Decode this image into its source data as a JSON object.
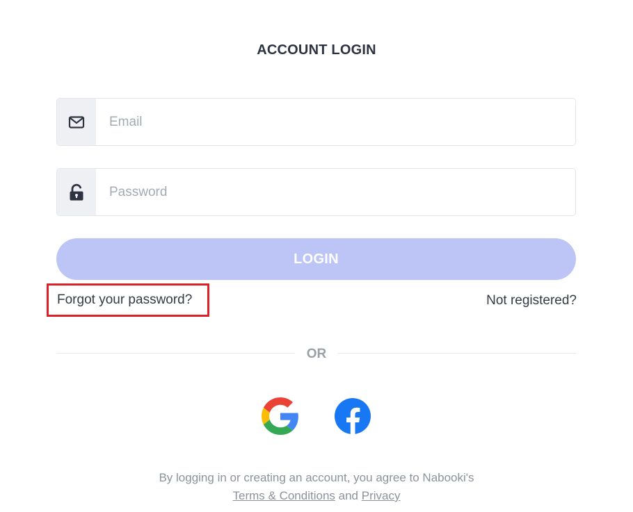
{
  "header": {
    "title": "ACCOUNT LOGIN"
  },
  "form": {
    "email": {
      "placeholder": "Email",
      "icon": "envelope-icon"
    },
    "password": {
      "placeholder": "Password",
      "icon": "unlock-icon"
    },
    "login_label": "LOGIN",
    "forgot_label": "Forgot your password?",
    "not_registered_label": "Not registered?"
  },
  "divider": {
    "label": "OR"
  },
  "social": {
    "google_icon": "google-icon",
    "facebook_icon": "facebook-icon"
  },
  "footer": {
    "agreement_text": "By logging in or creating an account, you agree to Nabooki's",
    "terms_label": "Terms & Conditions",
    "and_text": "and",
    "privacy_label": "Privacy"
  },
  "colors": {
    "login_button": "#bcc5f5",
    "highlight_border": "#dd1f26",
    "facebook_blue": "#1877f2"
  }
}
